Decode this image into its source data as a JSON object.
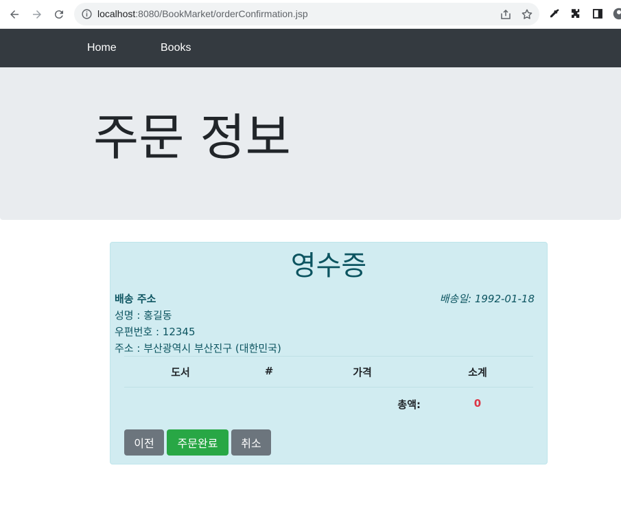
{
  "browser": {
    "url_host": "localhost",
    "url_rest": ":8080/BookMarket/orderConfirmation.jsp"
  },
  "nav": {
    "home": "Home",
    "books": "Books"
  },
  "jumbotron": {
    "title": "주문 정보"
  },
  "receipt": {
    "title": "영수증",
    "shipping_title": "배송 주소",
    "ship_date": "배송일: 1992-01-18",
    "name_line": "성명 : 홍길동",
    "zip_line": "우편번호 : 12345",
    "address_line": "주소 : 부산광역시 부산진구 (대한민국)",
    "table": {
      "headers": [
        "도서",
        "#",
        "가격",
        "소계"
      ]
    },
    "total_label": "총액:",
    "total_value": "0",
    "buttons": {
      "prev": "이전",
      "complete": "주문완료",
      "cancel": "취소"
    }
  },
  "colors": {
    "navbar": "#343a40",
    "jumbotron": "#e9ecef",
    "card_bg": "#d1ecf1",
    "card_text": "#0c5460",
    "total": "#dc3545",
    "btn_secondary": "#6c757d",
    "btn_success": "#28a745"
  }
}
